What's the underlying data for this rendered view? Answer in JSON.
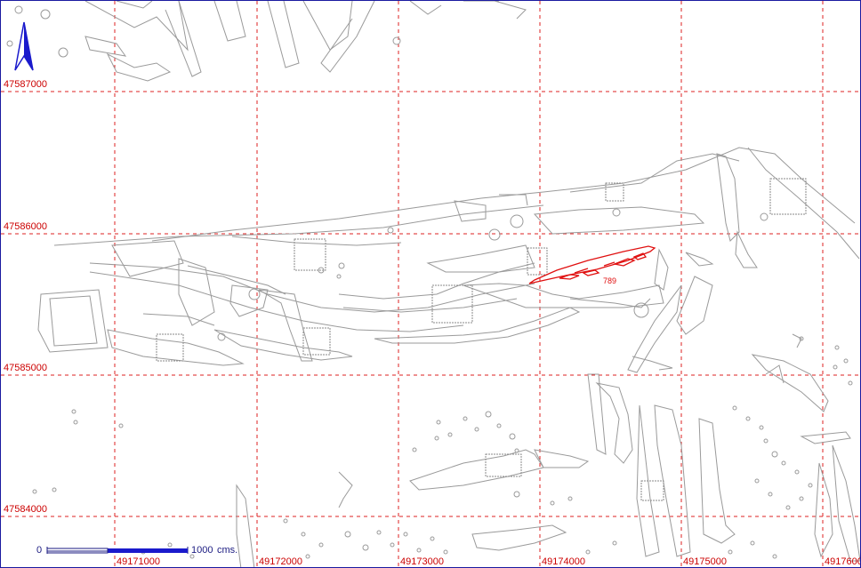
{
  "map": {
    "grid_color": "#dd2222",
    "feature_color": "#9a9a9a",
    "highlight_color": "#e01010",
    "frame_color": "#1a1aa0",
    "y_labels": [
      "47587000",
      "47586000",
      "47585000",
      "47584000"
    ],
    "x_labels": [
      "49171000",
      "49172000",
      "49173000",
      "49174000",
      "49175000",
      "4917600"
    ],
    "highlight_label": "789",
    "scale": {
      "start": "0",
      "end": "1000",
      "unit": "cms."
    },
    "north_arrow": "north-arrow-icon"
  }
}
